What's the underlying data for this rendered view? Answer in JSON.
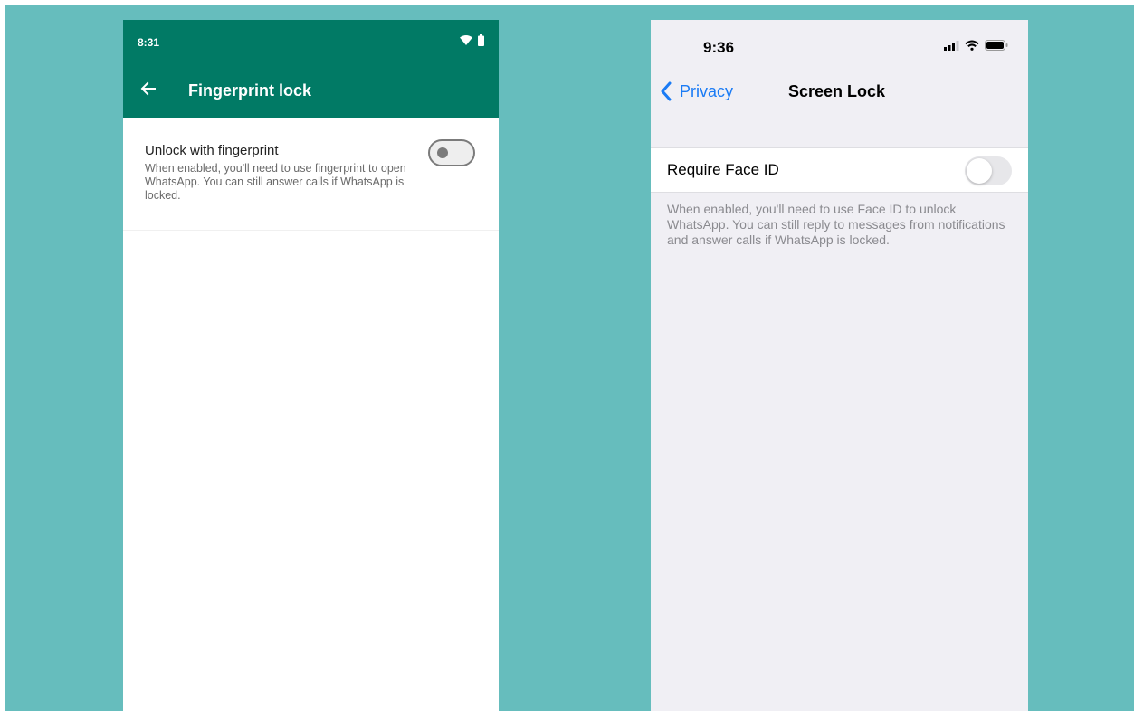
{
  "android": {
    "status_bar": {
      "time": "8:31",
      "wifi_icon": "wifi-icon",
      "battery_icon": "battery-icon"
    },
    "header": {
      "title": "Fingerprint lock",
      "back_icon": "back-arrow-icon",
      "background_color": "#017a65"
    },
    "setting": {
      "title": "Unlock with fingerprint",
      "description": "When enabled, you'll need to use fingerprint to open WhatsApp. You can still answer calls if WhatsApp is locked.",
      "toggle_on": false
    }
  },
  "ios": {
    "status_bar": {
      "time": "9:36",
      "signal_icon": "signal-icon",
      "wifi_icon": "wifi-icon",
      "battery_icon": "battery-icon"
    },
    "nav": {
      "back_label": "Privacy",
      "title": "Screen Lock",
      "back_icon": "chevron-left-icon",
      "accent_color": "#1a7bf5"
    },
    "setting": {
      "label": "Require Face ID",
      "toggle_on": false,
      "footnote": "When enabled, you'll need to use Face ID to unlock WhatsApp. You can still reply to messages from notifications and answer calls if WhatsApp is locked."
    }
  },
  "background_color": "#66bdbd"
}
